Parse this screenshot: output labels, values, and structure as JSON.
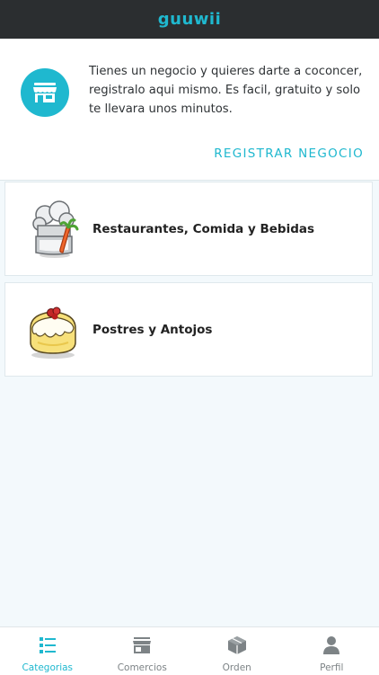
{
  "header": {
    "title": "guuwii"
  },
  "promo": {
    "icon": "store-icon",
    "text": "Tienes un negocio y quieres darte a coconcer, registralo aqui mismo. Es facil, gratuito y solo te llevara unos minutos.",
    "register_label": "REGISTRAR NEGOCIO"
  },
  "categories": [
    {
      "label": "Restaurantes, Comida y Bebidas",
      "icon": "chef-hat-carrot-icon"
    },
    {
      "label": "Postres y Antojos",
      "icon": "dessert-cake-icon"
    }
  ],
  "tabbar": {
    "active": "Categorias",
    "items": [
      {
        "label": "Categorias",
        "icon": "list-icon"
      },
      {
        "label": "Comercios",
        "icon": "store-icon"
      },
      {
        "label": "Orden",
        "icon": "box-icon"
      },
      {
        "label": "Perfil",
        "icon": "person-icon"
      }
    ]
  },
  "colors": {
    "accent": "#1fb8cf",
    "topbar": "#2b2e30",
    "background": "#f3f9fc"
  }
}
